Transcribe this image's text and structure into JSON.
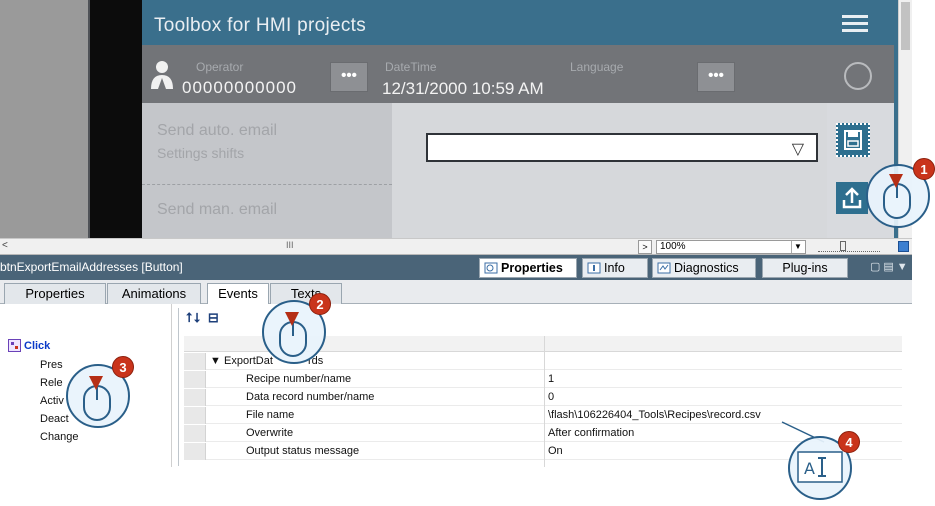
{
  "hmi": {
    "title": "Toolbox for HMI projects",
    "operator_label": "Operator",
    "operator_value": "00000000000",
    "datetime_label": "DateTime",
    "datetime_value": "12/31/2000 10:59 AM",
    "language_label": "Language",
    "dots_label": "•••",
    "send_auto_email": "Send auto. email",
    "settings_shifts": "Settings shifts",
    "send_man_email": "Send man. email"
  },
  "editor_status": {
    "zoom": "100%"
  },
  "inspector": {
    "object_title": "btnExportEmailAddresses [Button]",
    "tabs": [
      "Properties",
      "Info",
      "Diagnostics",
      "Plug-ins"
    ]
  },
  "subtabs": [
    "Properties",
    "Animations",
    "Events",
    "Texts"
  ],
  "events": {
    "list": [
      "Click",
      "Press",
      "Release",
      "Activate",
      "Deactivate",
      "Change"
    ],
    "list_visible": [
      "Click",
      "Pres",
      "Rele",
      "Activ",
      "Deact",
      "Change"
    ],
    "function_name_visible": "ExportDat",
    "function_name_suffix_visible": "rds",
    "params": [
      {
        "name": "Recipe number/name",
        "value": "1"
      },
      {
        "name": "Data record number/name",
        "value": "0"
      },
      {
        "name": "File name",
        "value": "\\flash\\106226404_Tools\\Recipes\\record.csv"
      },
      {
        "name": "Overwrite",
        "value": "After confirmation"
      },
      {
        "name": "Output status message",
        "value": "On"
      }
    ]
  },
  "callouts": [
    "1",
    "2",
    "3",
    "4"
  ],
  "colors": {
    "hmi_blue": "#3a6f8c",
    "inspector_bar": "#4a6478",
    "callout_red": "#c9341b"
  }
}
